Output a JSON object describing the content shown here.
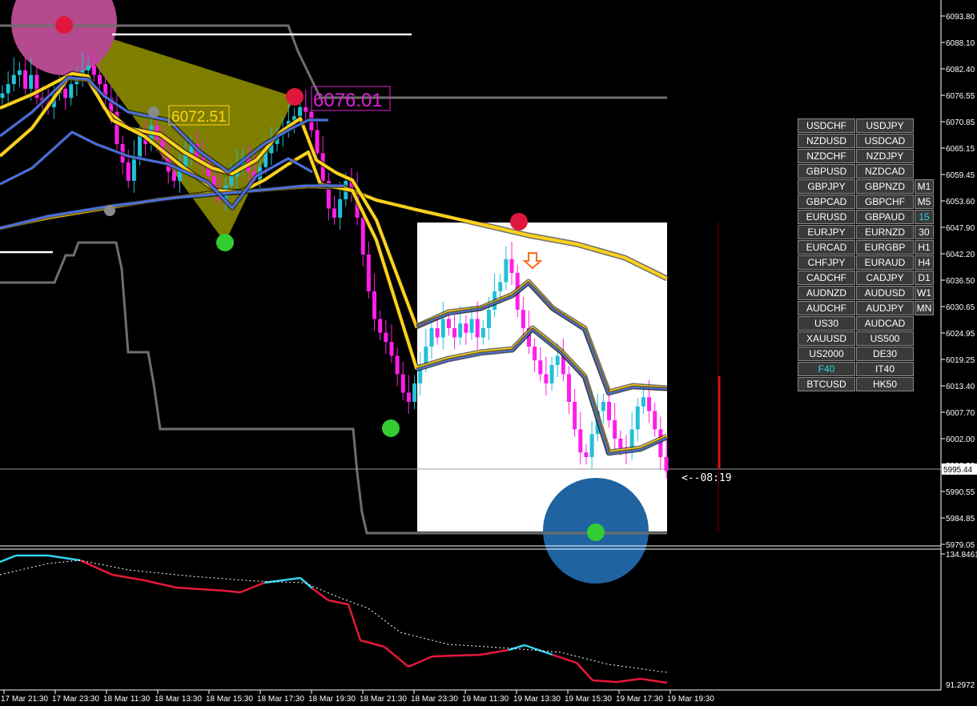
{
  "chart_data": {
    "type": "candlestick",
    "price_axis": {
      "ticks": [
        "6093.80",
        "6088.10",
        "6082.40",
        "6076.55",
        "6070.85",
        "6065.15",
        "6059.45",
        "6053.60",
        "6047.90",
        "6042.20",
        "6036.50",
        "6030.65",
        "6024.95",
        "6019.25",
        "6013.40",
        "6007.70",
        "6002.00",
        "5996.30",
        "5990.55",
        "5984.85",
        "5979.05"
      ],
      "current_price": "5995.44",
      "ylim": [
        5979.05,
        6093.8
      ]
    },
    "time_axis": {
      "ticks": [
        "17 Mar 21:30",
        "17 Mar 23:30",
        "18 Mar 11:30",
        "18 Mar 13:30",
        "18 Mar 15:30",
        "18 Mar 17:30",
        "18 Mar 19:30",
        "18 Mar 21:30",
        "18 Mar 23:30",
        "19 Mar 11:30",
        "19 Mar 13:30",
        "19 Mar 15:30",
        "19 Mar 17:30",
        "19 Mar 19:30"
      ]
    },
    "annotations": {
      "label_left": "6072.51",
      "label_right": "6076.01",
      "countdown": "<--08:19"
    },
    "indicator_axis": {
      "top": "134.8461",
      "bottom": "91.2972"
    },
    "colors": {
      "bull": "#22c0d8",
      "bear": "#ff1ee8",
      "ma_yellow": "#ffd21a",
      "ma_blue": "#4a6fdc",
      "channel": "#6e6e6e",
      "indicator_red": "#e8173c",
      "indicator_cyan": "#34d4f0"
    }
  },
  "panel": {
    "symbols": [
      [
        "USDCHF",
        "USDJPY"
      ],
      [
        "NZDUSD",
        "USDCAD"
      ],
      [
        "NZDCHF",
        "NZDJPY"
      ],
      [
        "GBPUSD",
        "NZDCAD"
      ],
      [
        "GBPJPY",
        "GBPNZD"
      ],
      [
        "GBPCAD",
        "GBPCHF"
      ],
      [
        "EURUSD",
        "GBPAUD"
      ],
      [
        "EURJPY",
        "EURNZD"
      ],
      [
        "EURCAD",
        "EURGBP"
      ],
      [
        "CHFJPY",
        "EURAUD"
      ],
      [
        "CADCHF",
        "CADJPY"
      ],
      [
        "AUDNZD",
        "AUDUSD"
      ],
      [
        "AUDCHF",
        "AUDJPY"
      ],
      [
        "US30",
        "AUDCAD"
      ],
      [
        "XAUUSD",
        "US500"
      ],
      [
        "US2000",
        "DE30"
      ],
      [
        "F40",
        "IT40"
      ],
      [
        "BTCUSD",
        "HK50"
      ]
    ],
    "active_symbol": "F40",
    "timeframes": [
      "M1",
      "M5",
      "15",
      "30",
      "H1",
      "H4",
      "D1",
      "W1",
      "MN"
    ],
    "active_timeframe": "15"
  }
}
